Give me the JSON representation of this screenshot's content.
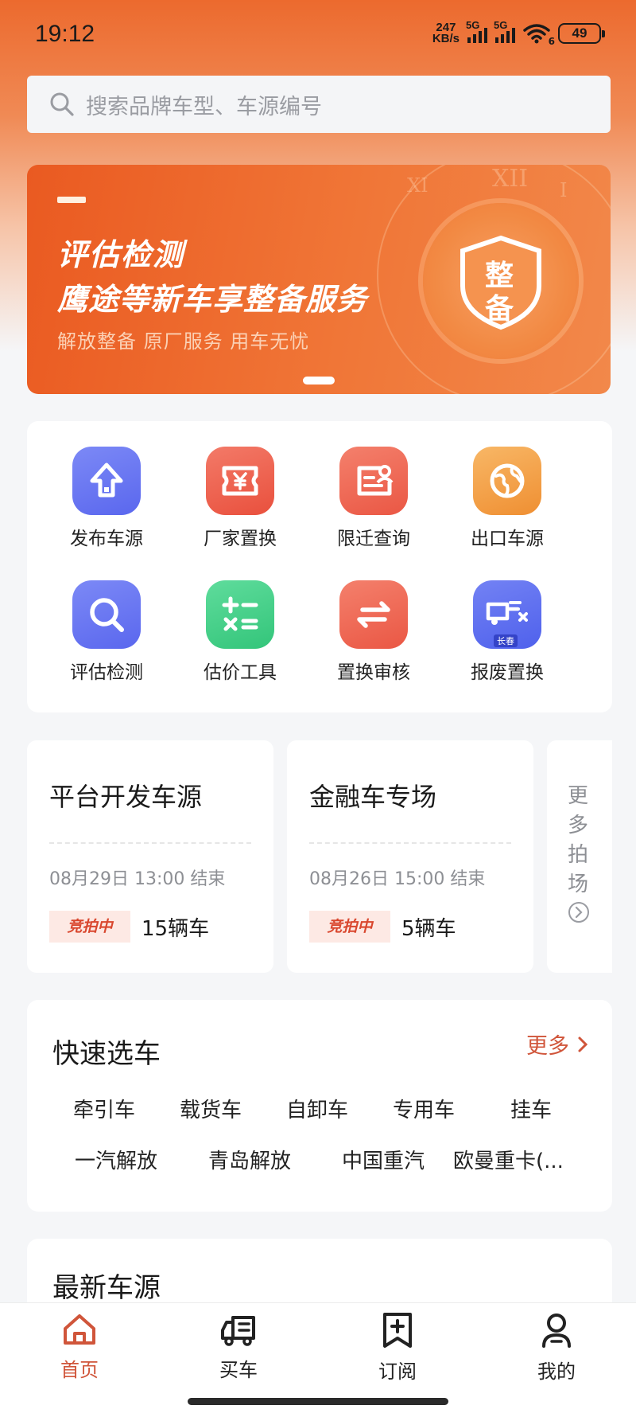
{
  "status": {
    "time": "19:12",
    "net_speed_value": "247",
    "net_speed_unit": "KB/s",
    "sim1": "5G",
    "sim2": "5G",
    "wifi_sub": "6",
    "battery": "49"
  },
  "search": {
    "placeholder": "搜索品牌车型、车源编号"
  },
  "banner": {
    "title1": "评估检测",
    "title2": "鹰途等新车享整备服务",
    "subtitle": "解放整备 原厂服务 用车无忧",
    "emblem_top": "整",
    "emblem_bottom": "备",
    "numerals": [
      "XII",
      "XI",
      "I"
    ],
    "active_page": 1
  },
  "grid": [
    {
      "label": "发布车源",
      "icon": "upload-icon",
      "color": "#6a77f2"
    },
    {
      "label": "厂家置换",
      "icon": "yuan-ticket-icon",
      "color": "#ee6150"
    },
    {
      "label": "限迁查询",
      "icon": "id-card-icon",
      "color": "#ef6b5a"
    },
    {
      "label": "出口车源",
      "icon": "globe-icon",
      "color": "#f4a247"
    },
    {
      "label": "评估检测",
      "icon": "magnifier-icon",
      "color": "#6676f1"
    },
    {
      "label": "估价工具",
      "icon": "calculator-icon",
      "color": "#3fcf86"
    },
    {
      "label": "置换审核",
      "icon": "exchange-arrows-icon",
      "color": "#ee6a55"
    },
    {
      "label": "报废置换",
      "icon": "scrap-truck-icon",
      "color": "#5a6ff0",
      "badge": "长春"
    }
  ],
  "auctions": [
    {
      "title": "平台开发车源",
      "time": "08月29日 13:00 结束",
      "status": "竞拍中",
      "count": "15辆车"
    },
    {
      "title": "金融车专场",
      "time": "08月26日 15:00 结束",
      "status": "竞拍中",
      "count": "5辆车"
    }
  ],
  "more_auctions": "更多拍场",
  "quick": {
    "title": "快速选车",
    "more": "更多",
    "types": [
      "牵引车",
      "载货车",
      "自卸车",
      "专用车",
      "挂车"
    ],
    "brands": [
      "一汽解放",
      "青岛解放",
      "中国重汽",
      "欧曼重卡(..."
    ]
  },
  "newest": {
    "title": "最新车源"
  },
  "tabs": [
    {
      "label": "首页",
      "icon": "home-icon",
      "active": true
    },
    {
      "label": "买车",
      "icon": "truck-icon",
      "active": false
    },
    {
      "label": "订阅",
      "icon": "bookmark-plus-icon",
      "active": false
    },
    {
      "label": "我的",
      "icon": "person-icon",
      "active": false
    }
  ],
  "colors": {
    "brand": "#ec6a2e",
    "accent_text": "#d0553a"
  }
}
